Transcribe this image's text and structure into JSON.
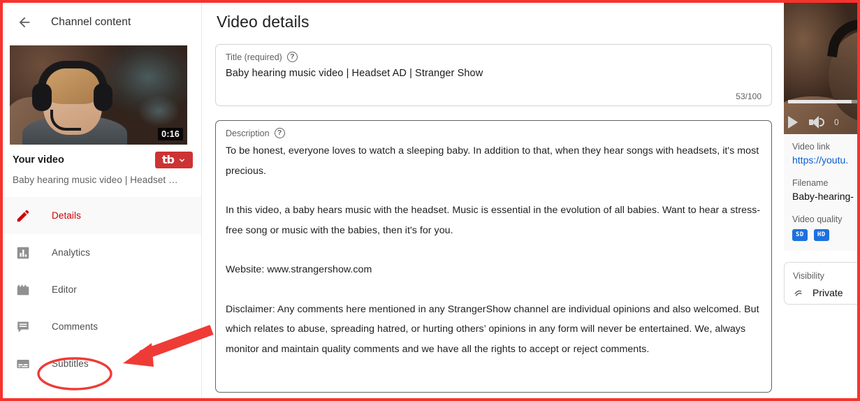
{
  "sidebar": {
    "back_icon": "back-arrow-icon",
    "header_title": "Channel content",
    "thumbnail": {
      "duration": "0:16"
    },
    "your_video_label": "Your video",
    "tubebuddy": {
      "logo": "tb",
      "chevron": "⌄"
    },
    "video_title_truncated": "Baby hearing music video | Headset …",
    "nav_items": [
      {
        "label": "Details",
        "icon": "pencil-icon",
        "active": true
      },
      {
        "label": "Analytics",
        "icon": "bar-chart-icon",
        "active": false
      },
      {
        "label": "Editor",
        "icon": "clapperboard-icon",
        "active": false
      },
      {
        "label": "Comments",
        "icon": "speech-bubble-icon",
        "active": false
      },
      {
        "label": "Subtitles",
        "icon": "subtitles-icon",
        "active": false
      }
    ]
  },
  "main": {
    "page_title": "Video details",
    "title_field": {
      "label": "Title (required)",
      "help_icon": "?",
      "value": "Baby hearing music video | Headset AD | Stranger Show",
      "counter": "53/100"
    },
    "description_field": {
      "label": "Description",
      "help_icon": "?",
      "paragraphs": [
        "To be honest, everyone loves to watch a sleeping baby. In addition to that, when they hear songs with headsets, it's most precious.",
        "In this video, a baby hears music with the headset. Music is essential in the evolution of all babies. Want to hear a stress-free song or music with the babies, then it's for you.",
        "Website: www.strangershow.com",
        "Disclaimer: Any comments here mentioned in any StrangerShow channel are individual opinions and also welcomed. But which relates to abuse, spreading hatred, or hurting others’ opinions in any form will never be entertained. We, always monitor and maintain quality comments and we have all the rights to accept or reject comments."
      ]
    }
  },
  "right_panel": {
    "player": {
      "play_icon": "play-icon",
      "volume_icon": "volume-icon",
      "time": "0"
    },
    "video_link_label": "Video link",
    "video_link_value": "https://youtu.",
    "filename_label": "Filename",
    "filename_value": "Baby-hearing-",
    "video_quality_label": "Video quality",
    "quality_badges": [
      "SD",
      "HD"
    ],
    "visibility_label": "Visibility",
    "visibility_value": "Private"
  },
  "annotations": {
    "highlight_target": "Subtitles",
    "arrow_color": "#ef3b36",
    "circle_color": "#ef3b36",
    "frame_color": "#f8322c"
  }
}
